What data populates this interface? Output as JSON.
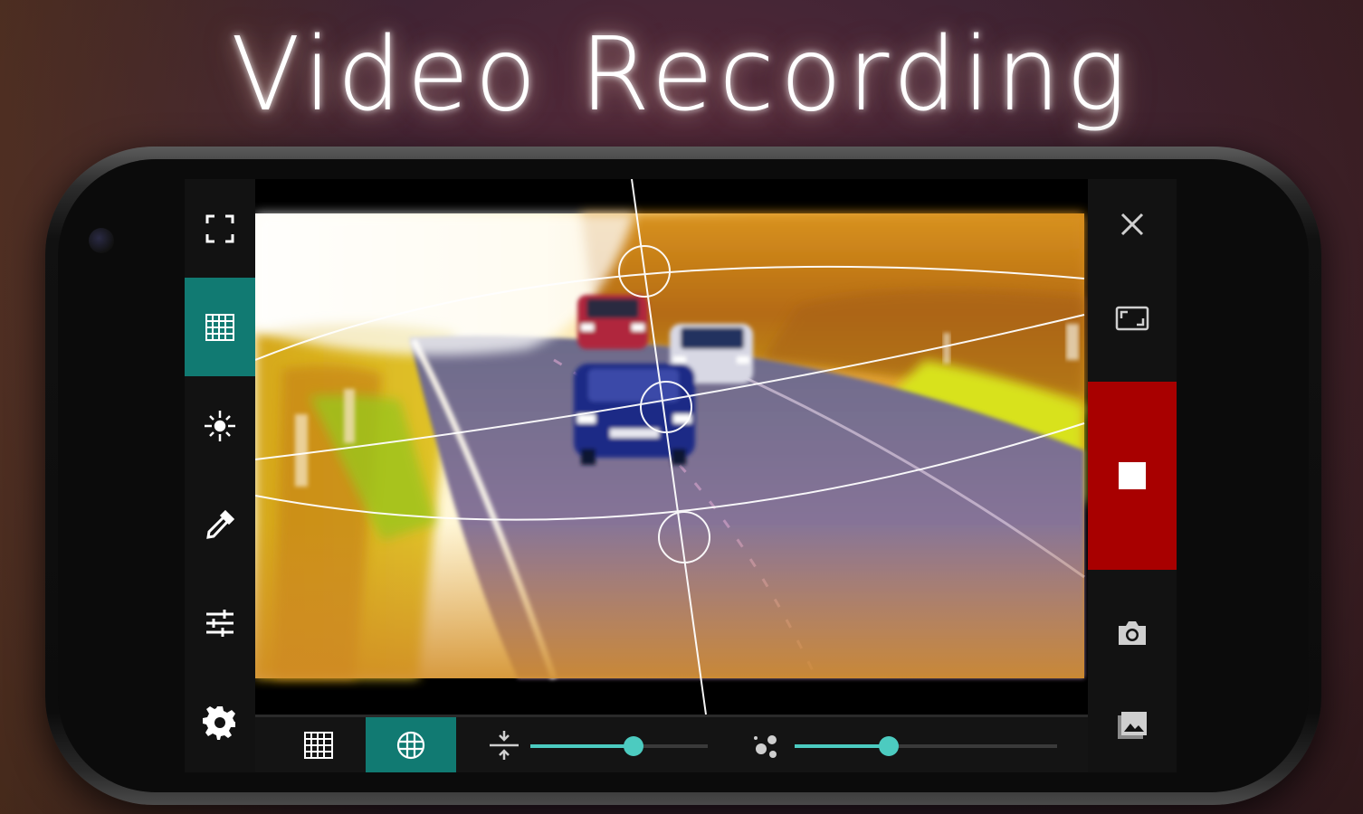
{
  "headline": "Video Recording",
  "colors": {
    "accent": "#117a72",
    "slider": "#4ccbc0",
    "record": "#a80000",
    "bar": "#121212"
  },
  "left_toolbar": [
    {
      "icon": "fullscreen-icon",
      "active": false
    },
    {
      "icon": "grid-icon",
      "active": true
    },
    {
      "icon": "focus-icon",
      "active": false
    },
    {
      "icon": "eyedropper-icon",
      "active": false
    },
    {
      "icon": "sliders-icon",
      "active": false
    },
    {
      "icon": "gear-icon",
      "active": false
    }
  ],
  "right_toolbar": [
    {
      "icon": "close-icon"
    },
    {
      "icon": "aspect-ratio-icon"
    },
    {
      "icon": "stop-icon"
    },
    {
      "icon": "camera-icon"
    },
    {
      "icon": "gallery-icon"
    }
  ],
  "bottom_toolbar": {
    "grid_icon": "grid-icon",
    "target_icon": "target-grid-icon",
    "compress_icon": "compress-icon",
    "blur_icon": "blur-icon",
    "slider_1_value": 0.58,
    "slider_2_value": 0.36
  }
}
